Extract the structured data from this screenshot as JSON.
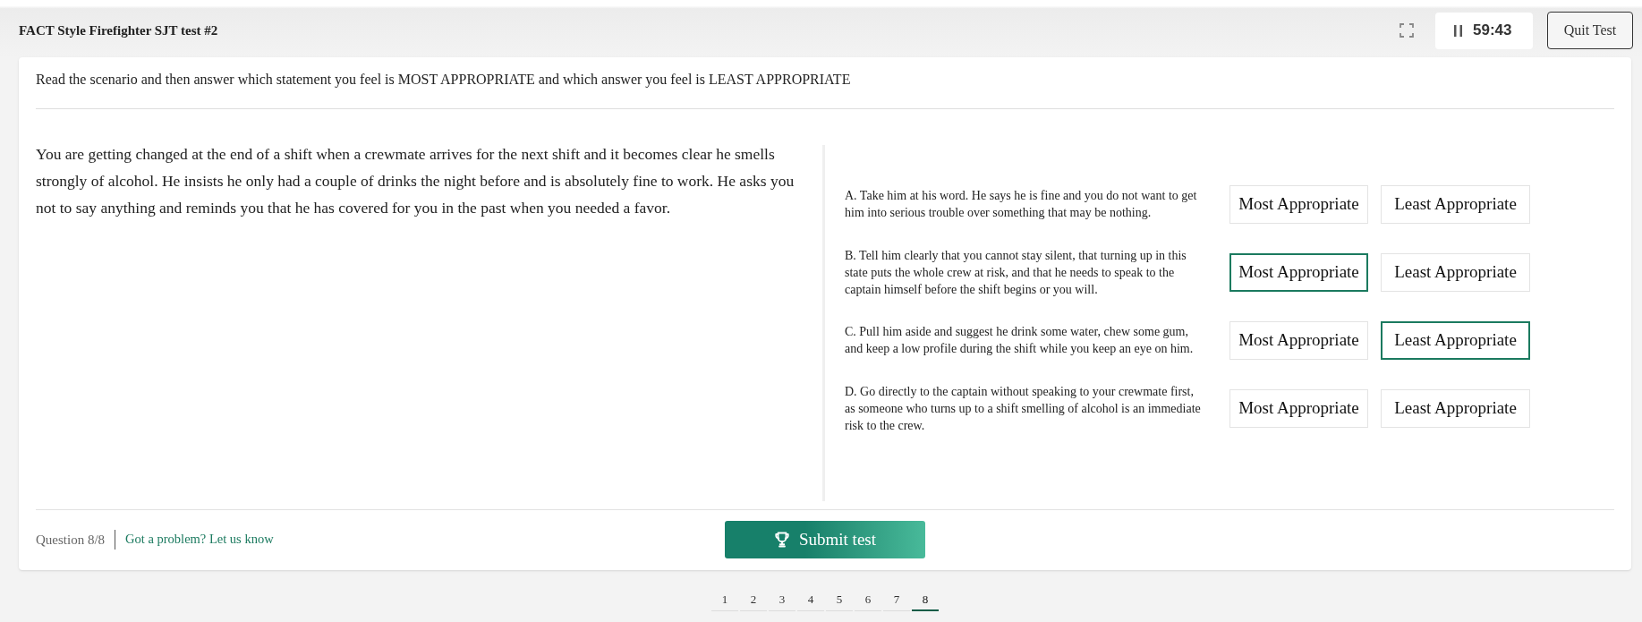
{
  "header": {
    "title": "FACT Style Firefighter SJT test #2",
    "timer": "59:43",
    "quit_button": "Quit Test"
  },
  "instructions": "Read the scenario and then answer which statement you feel is MOST APPROPRIATE and which answer you feel is LEAST APPROPRIATE",
  "scenario": "You are getting changed at the end of a shift when a crewmate arrives for the next shift and it becomes clear he smells strongly of alcohol. He insists he only had a couple of drinks the night before and is absolutely fine to work. He asks you not to say anything and reminds you that he has covered for you in the past when you needed a favor.",
  "options": [
    {
      "text": "A. Take him at his word. He says he is fine and you do not want to get him into serious trouble over something that may be nothing.",
      "choices": [
        {
          "label": "Most Appropriate",
          "selected": false
        },
        {
          "label": "Least Appropriate",
          "selected": false
        }
      ]
    },
    {
      "text": "B. Tell him clearly that you cannot stay silent, that turning up in this state puts the whole crew at risk, and that he needs to speak to the captain himself before the shift begins or you will.",
      "choices": [
        {
          "label": "Most Appropriate",
          "selected": true
        },
        {
          "label": "Least Appropriate",
          "selected": false
        }
      ]
    },
    {
      "text": "C. Pull him aside and suggest he drink some water, chew some gum, and keep a low profile during the shift while you keep an eye on him.",
      "choices": [
        {
          "label": "Most Appropriate",
          "selected": false
        },
        {
          "label": "Least Appropriate",
          "selected": true
        }
      ]
    },
    {
      "text": "D. Go directly to the captain without speaking to your crewmate first, as someone who turns up to a shift smelling of alcohol is an immediate risk to the crew.",
      "choices": [
        {
          "label": "Most Appropriate",
          "selected": false
        },
        {
          "label": "Least Appropriate",
          "selected": false
        }
      ]
    }
  ],
  "footer": {
    "question_counter": "Question 8/8",
    "report_link": "Got a problem? Let us know",
    "submit_button": "Submit test"
  },
  "pagination": [
    {
      "label": "1",
      "selected": false
    },
    {
      "label": "2",
      "selected": false
    },
    {
      "label": "3",
      "selected": false
    },
    {
      "label": "4",
      "selected": false
    },
    {
      "label": "5",
      "selected": false
    },
    {
      "label": "6",
      "selected": false
    },
    {
      "label": "7",
      "selected": false
    },
    {
      "label": "8",
      "selected": true
    }
  ]
}
